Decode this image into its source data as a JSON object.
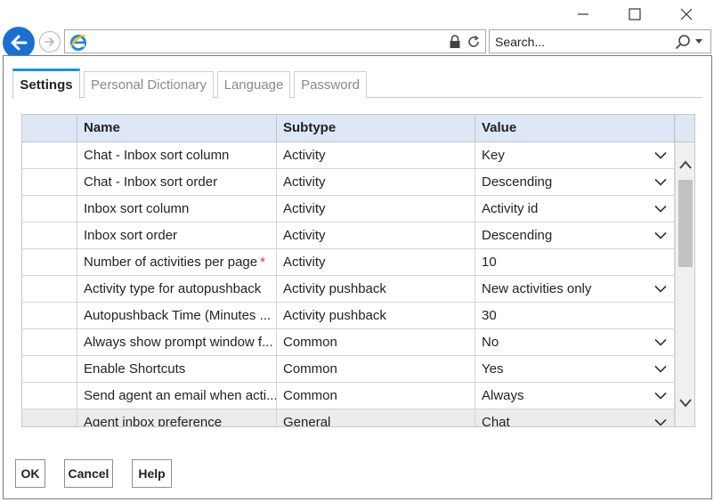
{
  "browser": {
    "search_placeholder": "Search..."
  },
  "tabs": [
    {
      "label": "Settings",
      "active": true
    },
    {
      "label": "Personal Dictionary",
      "active": false
    },
    {
      "label": "Language",
      "active": false
    },
    {
      "label": "Password",
      "active": false
    }
  ],
  "grid": {
    "columns": [
      "Name",
      "Subtype",
      "Value"
    ],
    "rows": [
      {
        "name": "Chat - Inbox sort column",
        "subtype": "Activity",
        "value": "Key",
        "dropdown": true
      },
      {
        "name": "Chat - Inbox sort order",
        "subtype": "Activity",
        "value": "Descending",
        "dropdown": true
      },
      {
        "name": "Inbox sort column",
        "subtype": "Activity",
        "value": "Activity id",
        "dropdown": true
      },
      {
        "name": "Inbox sort order",
        "subtype": "Activity",
        "value": "Descending",
        "dropdown": true
      },
      {
        "name": "Number of activities per page",
        "required": "*",
        "subtype": "Activity",
        "value": "10",
        "dropdown": false
      },
      {
        "name": "Activity type for autopushback",
        "subtype": "Activity pushback",
        "value": "New activities only",
        "dropdown": true
      },
      {
        "name": "Autopushback Time (Minutes ...",
        "subtype": "Activity pushback",
        "value": "30",
        "dropdown": false
      },
      {
        "name": "Always show prompt window f...",
        "subtype": "Common",
        "value": "No",
        "dropdown": true
      },
      {
        "name": "Enable Shortcuts",
        "subtype": "Common",
        "value": "Yes",
        "dropdown": true
      },
      {
        "name": "Send agent an email when acti...",
        "subtype": "Common",
        "value": "Always",
        "dropdown": true
      },
      {
        "name": "Agent inbox preference",
        "subtype": "General",
        "value": "Chat",
        "dropdown": true
      }
    ]
  },
  "buttons": {
    "ok": "OK",
    "cancel": "Cancel",
    "help": "Help"
  },
  "colors": {
    "accent": "#1a6fd1",
    "tab_accent": "#1e91d6",
    "header_bg": "#dde7f6",
    "required": "#d9342b"
  },
  "icons": [
    "minimize-icon",
    "maximize-icon",
    "close-icon",
    "back-arrow-icon",
    "forward-arrow-icon",
    "ie-logo-icon",
    "lock-icon",
    "refresh-icon",
    "search-icon",
    "chevron-down-icon",
    "scroll-up-icon",
    "scroll-down-icon"
  ]
}
